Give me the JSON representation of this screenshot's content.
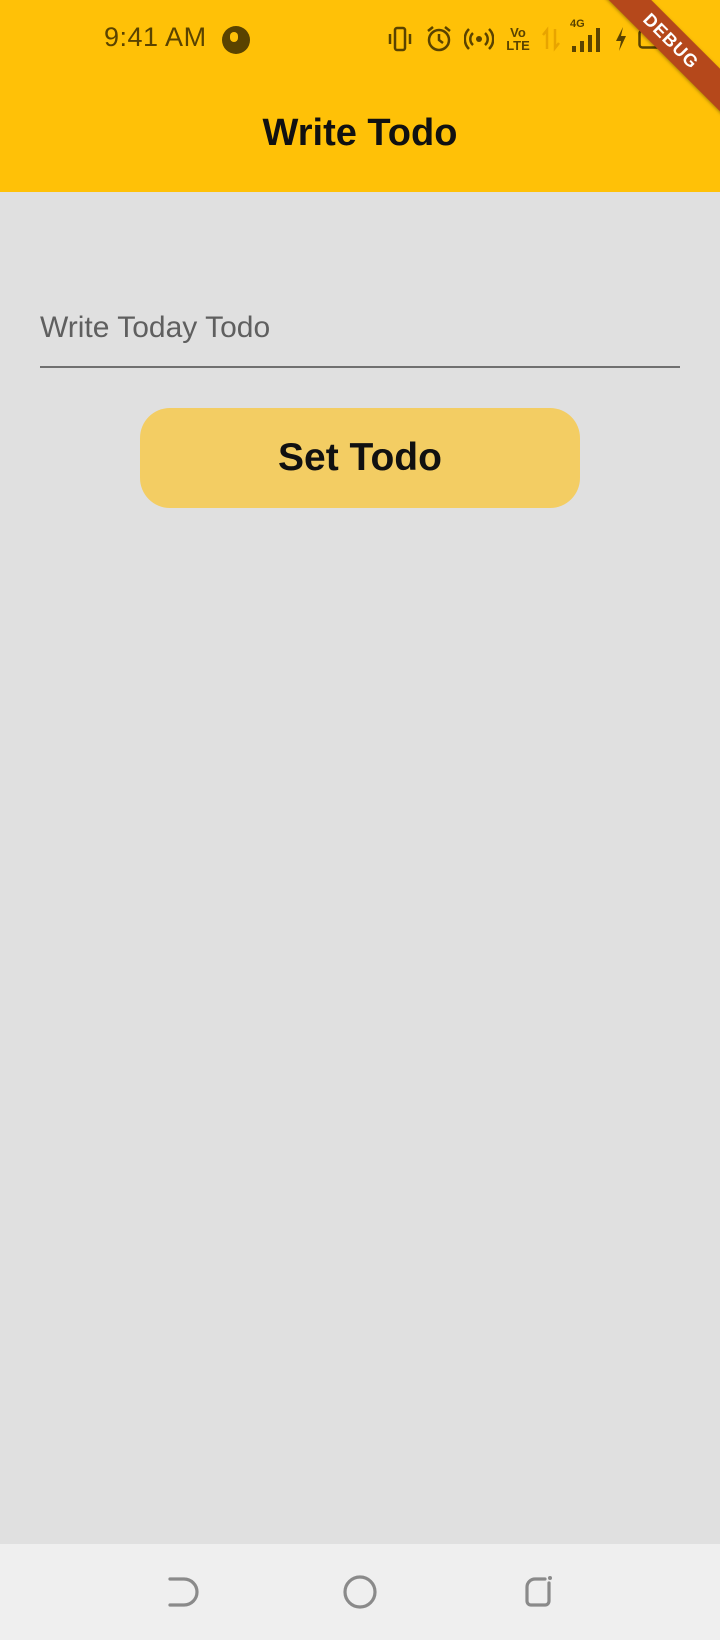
{
  "status_bar": {
    "time": "9:41 AM",
    "lte_top": "Vo",
    "lte_bottom": "LTE",
    "network": "4G",
    "icons": [
      "app-notification-icon",
      "vibrate-icon",
      "alarm-icon",
      "hotspot-icon",
      "volte-icon",
      "data-arrows-icon",
      "signal-icon",
      "charging-icon",
      "battery-icon"
    ]
  },
  "debug_banner": "DEBUG",
  "app_bar": {
    "title": "Write Todo"
  },
  "form": {
    "placeholder": "Write Today Todo",
    "value": "",
    "button_label": "Set Todo"
  },
  "nav_bar": {
    "buttons": [
      "back-icon",
      "home-icon",
      "recents-icon"
    ]
  },
  "colors": {
    "app_bar": "#ffc107",
    "background": "#e0e0e0",
    "button": "#f3cd63",
    "debug_ribbon": "#b5481b",
    "nav_bar": "#efefef"
  }
}
